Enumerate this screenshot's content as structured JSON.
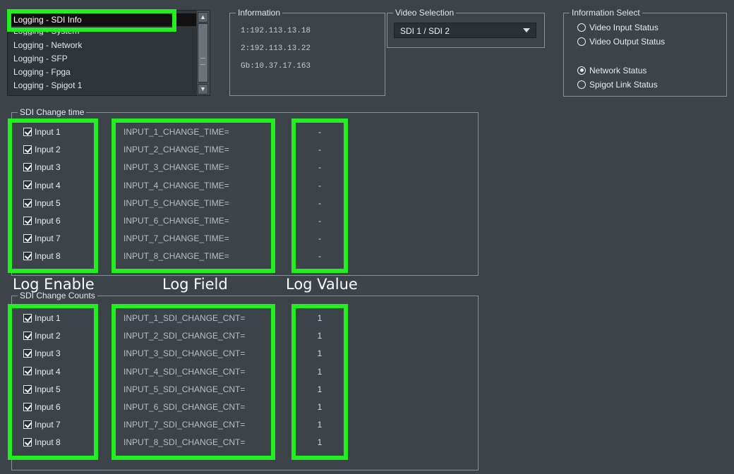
{
  "log_list": {
    "items": [
      {
        "label": "Logging - SDI Info",
        "selected": true
      },
      {
        "label": "Logging - System"
      },
      {
        "label": "Logging - Network"
      },
      {
        "label": "Logging - SFP"
      },
      {
        "label": "Logging - Fpga"
      },
      {
        "label": "Logging - Spigot 1"
      }
    ]
  },
  "information": {
    "title": "Information",
    "lines": [
      "1:192.113.13.18",
      "2:192.113.13.22",
      "Gb:10.37.17.163"
    ]
  },
  "video_selection": {
    "title": "Video Selection",
    "selected": "SDI 1 / SDI 2"
  },
  "information_select": {
    "title": "Information Select",
    "options": [
      {
        "label": "Video Input Status",
        "checked": false
      },
      {
        "label": "Video Output Status",
        "checked": false
      },
      {
        "label": "Network Status",
        "checked": true
      },
      {
        "label": "Spigot Link Status",
        "checked": false
      }
    ]
  },
  "sdi_change_time": {
    "title": "SDI Change time",
    "rows": [
      {
        "input": "Input 1",
        "field": "INPUT_1_CHANGE_TIME=",
        "value": "-"
      },
      {
        "input": "Input 2",
        "field": "INPUT_2_CHANGE_TIME=",
        "value": "-"
      },
      {
        "input": "Input 3",
        "field": "INPUT_3_CHANGE_TIME=",
        "value": "-"
      },
      {
        "input": "Input 4",
        "field": "INPUT_4_CHANGE_TIME=",
        "value": "-"
      },
      {
        "input": "Input 5",
        "field": "INPUT_5_CHANGE_TIME=",
        "value": "-"
      },
      {
        "input": "Input 6",
        "field": "INPUT_6_CHANGE_TIME=",
        "value": "-"
      },
      {
        "input": "Input 7",
        "field": "INPUT_7_CHANGE_TIME=",
        "value": "-"
      },
      {
        "input": "Input 8",
        "field": "INPUT_8_CHANGE_TIME=",
        "value": "-"
      }
    ]
  },
  "sdi_change_counts": {
    "title": "SDI Change Counts",
    "rows": [
      {
        "input": "Input 1",
        "field": "INPUT_1_SDI_CHANGE_CNT=",
        "value": "1"
      },
      {
        "input": "Input 2",
        "field": "INPUT_2_SDI_CHANGE_CNT=",
        "value": "1"
      },
      {
        "input": "Input 3",
        "field": "INPUT_3_SDI_CHANGE_CNT=",
        "value": "1"
      },
      {
        "input": "Input 4",
        "field": "INPUT_4_SDI_CHANGE_CNT=",
        "value": "1"
      },
      {
        "input": "Input 5",
        "field": "INPUT_5_SDI_CHANGE_CNT=",
        "value": "1"
      },
      {
        "input": "Input 6",
        "field": "INPUT_6_SDI_CHANGE_CNT=",
        "value": "1"
      },
      {
        "input": "Input 7",
        "field": "INPUT_7_SDI_CHANGE_CNT=",
        "value": "1"
      },
      {
        "input": "Input 8",
        "field": "INPUT_8_SDI_CHANGE_CNT=",
        "value": "1"
      }
    ]
  },
  "callouts": {
    "log_enable": "Log Enable",
    "log_field": "Log Field",
    "log_value": "Log Value"
  },
  "colors": {
    "background": "#3c4349",
    "highlight": "#22ee22",
    "selection": "#111111"
  }
}
